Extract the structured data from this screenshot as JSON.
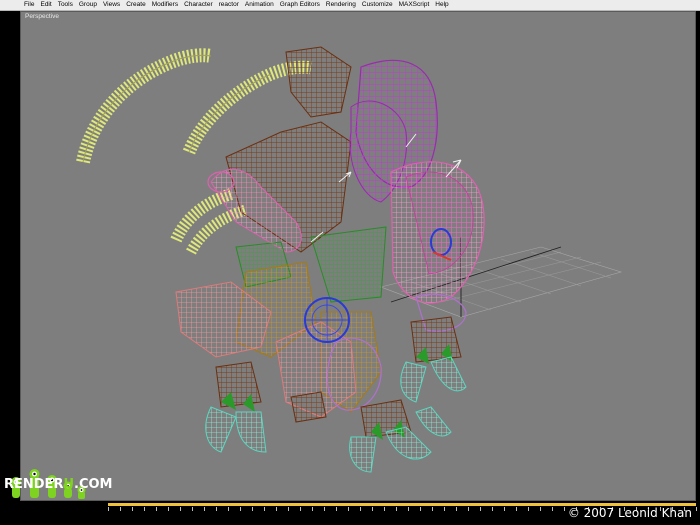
{
  "menu": {
    "items": [
      "File",
      "Edit",
      "Tools",
      "Group",
      "Views",
      "Create",
      "Modifiers",
      "Character",
      "reactor",
      "Animation",
      "Graph Editors",
      "Rendering",
      "Customize",
      "MAXScript",
      "Help"
    ]
  },
  "viewport": {
    "label": "Perspective"
  },
  "watermark": {
    "brand_prefix": "RENDER",
    "brand_accent": "U",
    "brand_suffix": ".COM",
    "copyright": "© 2007 Leonid Khan"
  },
  "colors": {
    "viewport_bg": "#7e7e7e",
    "timeline_track": "#f0c23b",
    "brand_accent": "#7ed321"
  }
}
